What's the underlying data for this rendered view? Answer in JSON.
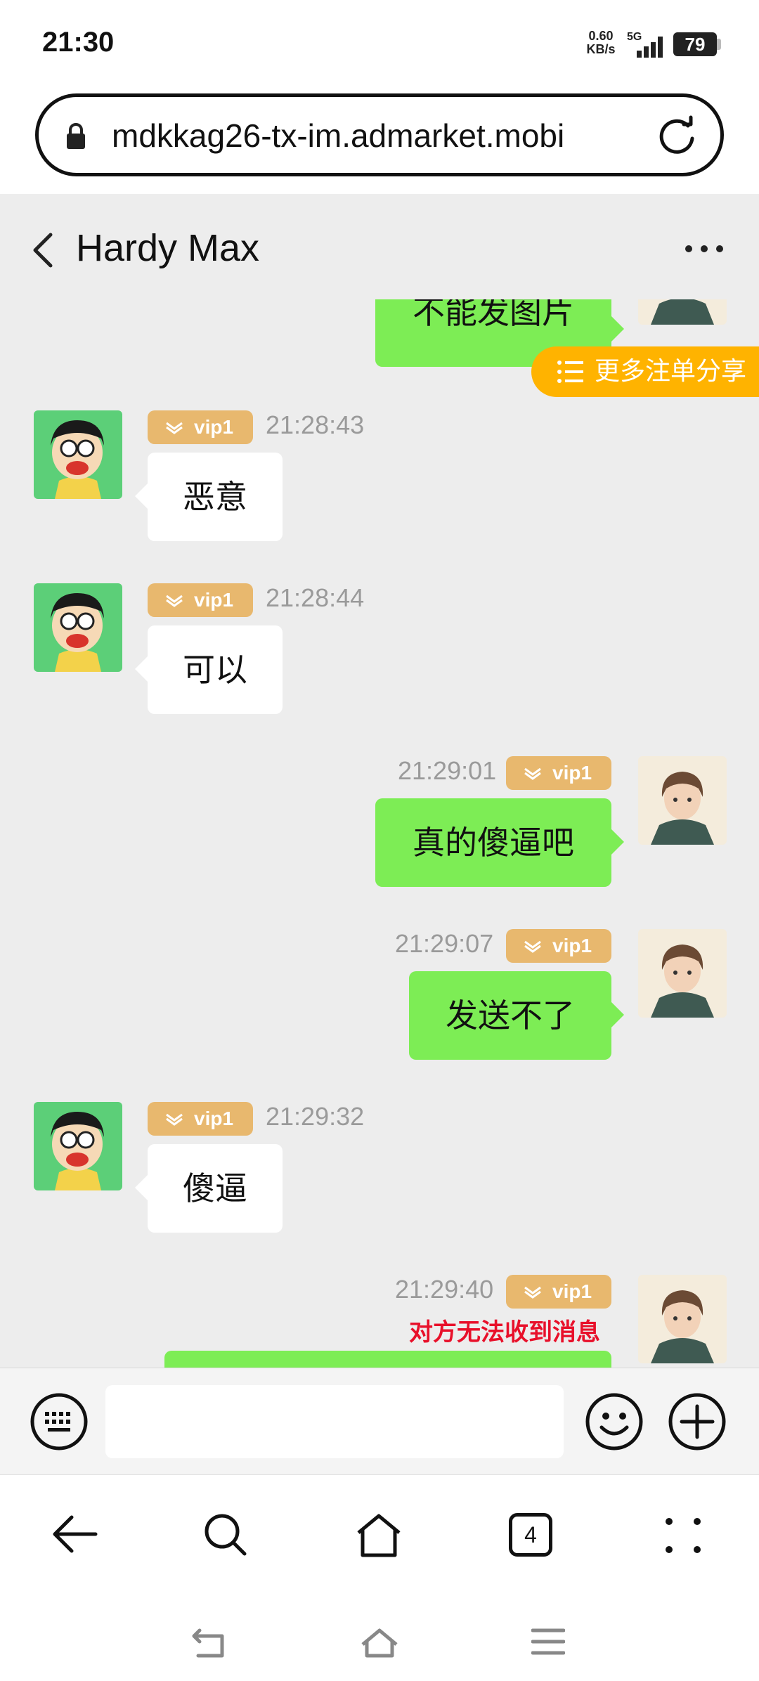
{
  "status_bar": {
    "time": "21:30",
    "net_speed_value": "0.60",
    "net_speed_unit": "KB/s",
    "network_type": "5G",
    "battery": "79"
  },
  "browser": {
    "url": "mdkkag26-tx-im.admarket.mobi",
    "tab_count": "4"
  },
  "chat": {
    "title": "Hardy Max",
    "share_button_label": "更多注单分享",
    "messages": [
      {
        "side": "out",
        "text": "不能发图片"
      },
      {
        "side": "in",
        "badge": "vip1",
        "time": "21:28:43",
        "text": "恶意"
      },
      {
        "side": "in",
        "badge": "vip1",
        "time": "21:28:44",
        "text": "可以"
      },
      {
        "side": "out",
        "badge": "vip1",
        "time": "21:29:01",
        "text": "真的傻逼吧"
      },
      {
        "side": "out",
        "badge": "vip1",
        "time": "21:29:07",
        "text": "发送不了"
      },
      {
        "side": "in",
        "badge": "vip1",
        "time": "21:29:32",
        "text": "傻逼"
      },
      {
        "side": "out",
        "badge": "vip1",
        "time": "21:29:40",
        "text": "",
        "error": "对方无法收到消息"
      }
    ]
  },
  "input": {
    "placeholder": ""
  },
  "colors": {
    "outgoing_bubble": "#7ded55",
    "incoming_bubble": "#ffffff",
    "vip_badge": "#e8b86e",
    "share_pill": "#ffb300",
    "error_text": "#e8102a"
  },
  "icons": [
    "lock-icon",
    "reload-icon",
    "back-icon",
    "more-icon",
    "list-icon",
    "keyboard-icon",
    "emoji-icon",
    "plus-icon",
    "back-arrow-icon",
    "search-icon",
    "home-icon",
    "tabs-icon",
    "menu-dots-icon"
  ]
}
